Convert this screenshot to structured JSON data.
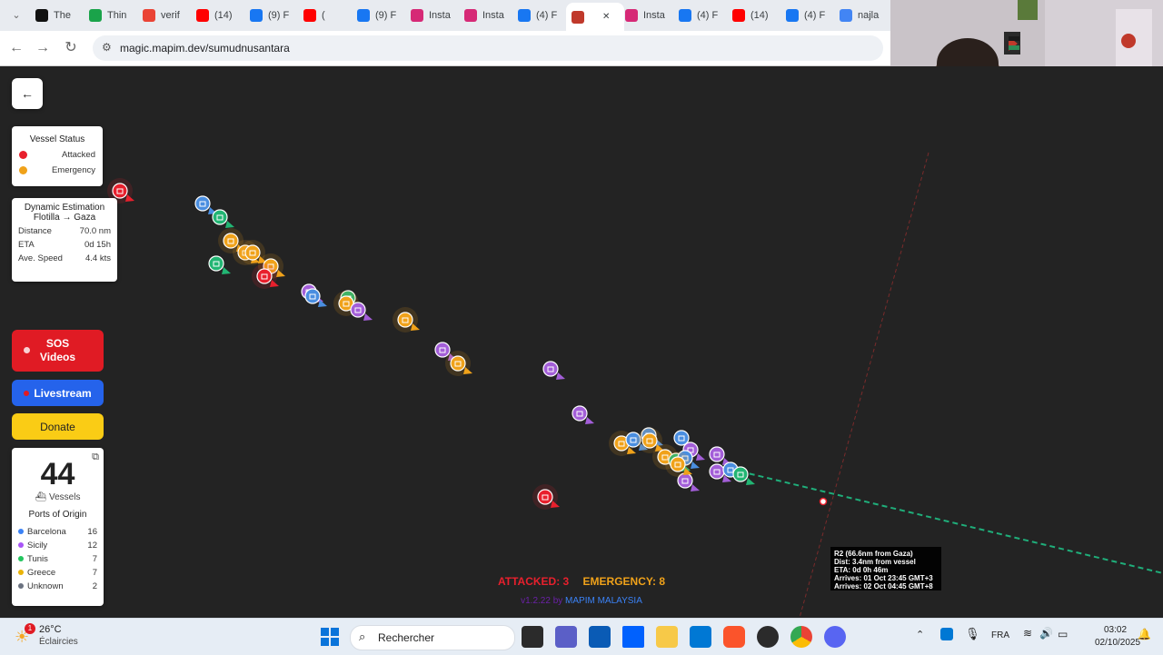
{
  "browser": {
    "tabs": [
      {
        "label": "The",
        "color": "#111111"
      },
      {
        "label": "Thin",
        "color": "#1aa34a"
      },
      {
        "label": "verif",
        "color": "#ea4335"
      },
      {
        "label": "(14)",
        "color": "#ff0000"
      },
      {
        "label": "(9) F",
        "color": "#1877f2"
      },
      {
        "label": "(",
        "color": "#ff0000"
      },
      {
        "label": "(9) F",
        "color": "#1877f2"
      },
      {
        "label": "Insta",
        "color": "#d62976"
      },
      {
        "label": "Insta",
        "color": "#d62976"
      },
      {
        "label": "(4) F",
        "color": "#1877f2"
      },
      {
        "label": "",
        "color": "#c0392b"
      },
      {
        "label": "Insta",
        "color": "#d62976"
      },
      {
        "label": "(4) F",
        "color": "#1877f2"
      },
      {
        "label": "(14)",
        "color": "#ff0000"
      },
      {
        "label": "(4) F",
        "color": "#1877f2"
      },
      {
        "label": "najla",
        "color": "#4285f4"
      }
    ],
    "url": "magic.mapim.dev/sumudnusantara"
  },
  "legend": {
    "title": "Vessel Status",
    "items": [
      {
        "label": "Attacked",
        "color": "#e8202d"
      },
      {
        "label": "Emergency",
        "color": "#f0a21a"
      }
    ]
  },
  "estimation": {
    "title": "Dynamic Estimation",
    "subtitle": "Flotilla → Gaza",
    "rows": [
      {
        "label": "Distance",
        "value": "70.0 nm"
      },
      {
        "label": "ETA",
        "value": "0d 15h"
      },
      {
        "label": "Ave. Speed",
        "value": "4.4 kts"
      }
    ]
  },
  "buttons": {
    "back": "←",
    "sos_line1": "SOS",
    "sos_line2": "Videos",
    "livestream": "Livestream",
    "donate": "Donate"
  },
  "vessels": {
    "count": "44",
    "count_label": "Vessels",
    "origin_title": "Ports of Origin",
    "origins": [
      {
        "label": "Barcelona",
        "value": "16",
        "color": "#3b82f6"
      },
      {
        "label": "Sicily",
        "value": "12",
        "color": "#a855f7"
      },
      {
        "label": "Tunis",
        "value": "7",
        "color": "#22c55e"
      },
      {
        "label": "Greece",
        "value": "7",
        "color": "#eab308"
      },
      {
        "label": "Unknown",
        "value": "2",
        "color": "#6b7280"
      }
    ]
  },
  "tooltip": {
    "line1": "R2 (66.6nm from Gaza)",
    "line2": "Dist: 3.4nm from vessel",
    "line3": "ETA: 0d 0h 46m",
    "line4": "Arrives: 01 Oct 23:45 GMT+3",
    "line5": "Arrives: 02 Oct 04:45 GMT+8"
  },
  "status": {
    "attacked": "ATTACKED: 3",
    "emergency": "EMERGENCY: 8",
    "version": "v1.2.22 by",
    "credit": "MAPIM MALAYSIA"
  },
  "taskbar": {
    "weather_temp": "26°C",
    "weather_desc": "Éclaircies",
    "weather_badge": "1",
    "search_placeholder": "Rechercher",
    "language": "FRA",
    "time": "03:02",
    "date": "02/10/2025"
  }
}
